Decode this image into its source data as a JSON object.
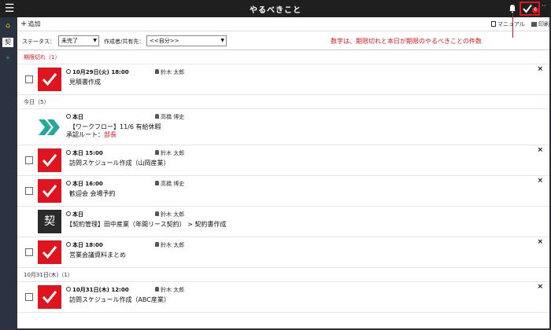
{
  "header": {
    "title": "やるべきこと",
    "badge_count": "6",
    "more_label": "··"
  },
  "sidebar": {
    "kei_label": "契"
  },
  "toolbar": {
    "add_label": "追加",
    "manual_label": "マニュアル",
    "print_label": "印刷"
  },
  "filters": {
    "status_label": "ステータス：",
    "status_value": "未完了",
    "creator_label": "作成者/共有先：",
    "creator_value": "<<自分>>"
  },
  "annotation": {
    "text": "数字は、期限切れと本日が期限のやるべきことの件数"
  },
  "sections": {
    "overdue": "期限切れ（1）",
    "today": "今日（5）",
    "oct31": "10月31日(木)（1）"
  },
  "tasks": [
    {
      "when": "10月29日(火) 18:00",
      "owner": "鈴木 太郎",
      "subject": "見積書作成"
    },
    {
      "when": "本日",
      "owner": "高橋 博史",
      "subject": "【ワークフロー】11/6 有給休暇",
      "route_label": "承認ルート：",
      "route_value": "部長"
    },
    {
      "when": "本日 15:00",
      "owner": "鈴木 太郎",
      "subject": "訪問スケジュール作成（山岡産業）"
    },
    {
      "when": "本日 16:00",
      "owner": "高橋 博史",
      "subject": "歓迎会 会場予約"
    },
    {
      "when": "本日",
      "owner": "鈴木 太郎",
      "subject": "【契約管理】田中産業（年間リース契約） > 契約書作成",
      "tile_label": "契"
    },
    {
      "when": "本日 18:00",
      "owner": "鈴木 太郎",
      "subject": "営業会議資料まとめ"
    },
    {
      "when": "10月31日(木) 12:00",
      "owner": "鈴木 太郎",
      "subject": "訪問スケジュール作成（ABC産業）"
    }
  ],
  "colors": {
    "accent_red": "#e0141e",
    "topbar": "#1f1f1f",
    "workflow_teal": "#21a99b"
  }
}
